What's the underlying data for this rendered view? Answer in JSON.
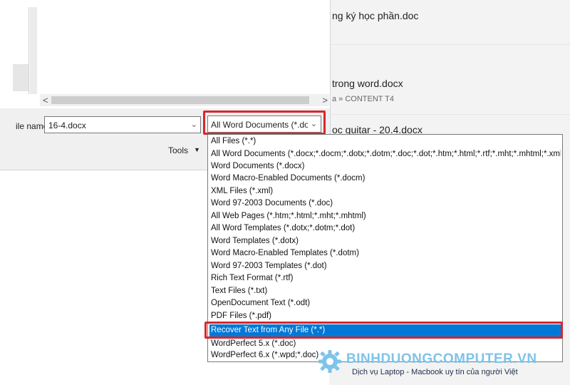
{
  "background_recent": [
    {
      "title": "ng ký học phần.doc",
      "sub": ""
    },
    {
      "title": "trong word.docx",
      "sub": "a » CONTENT T4"
    },
    {
      "title": "oc guitar - 20.4.docx",
      "sub": ""
    }
  ],
  "dialog": {
    "file_name_label": "ile name:",
    "file_name_value": "16-4.docx",
    "file_type_selected": "All Word Documents (*.docx;*.d",
    "tools_label": "Tools",
    "scroll_left": "<",
    "scroll_right": ">"
  },
  "dropdown_items": [
    {
      "label": "All Files (*.*)"
    },
    {
      "label": "All Word Documents (*.docx;*.docm;*.dotx;*.dotm;*.doc;*.dot;*.htm;*.html;*.rtf;*.mht;*.mhtml;*.xml;*.odt;*.pdf)"
    },
    {
      "label": "Word Documents (*.docx)"
    },
    {
      "label": "Word Macro-Enabled Documents (*.docm)"
    },
    {
      "label": "XML Files (*.xml)"
    },
    {
      "label": "Word 97-2003 Documents (*.doc)"
    },
    {
      "label": "All Web Pages (*.htm;*.html;*.mht;*.mhtml)"
    },
    {
      "label": "All Word Templates (*.dotx;*.dotm;*.dot)"
    },
    {
      "label": "Word Templates (*.dotx)"
    },
    {
      "label": "Word Macro-Enabled Templates (*.dotm)"
    },
    {
      "label": "Word 97-2003 Templates (*.dot)"
    },
    {
      "label": "Rich Text Format (*.rtf)"
    },
    {
      "label": "Text Files (*.txt)"
    },
    {
      "label": "OpenDocument Text (*.odt)"
    },
    {
      "label": "PDF Files (*.pdf)"
    },
    {
      "label": "Recover Text from Any File (*.*)",
      "selected": true
    },
    {
      "label": "WordPerfect 5.x (*.doc)"
    },
    {
      "label": "WordPerfect 6.x (*.wpd;*.doc)"
    }
  ],
  "watermark": {
    "brand": "BINHDUONGCOMPUTER.VN",
    "tagline": "Dịch vụ Laptop - Macbook uy tín của người Việt"
  },
  "colors": {
    "highlight": "#0078d7",
    "annotation_red": "#d9262b",
    "brand_blue": "#7ec3ea"
  }
}
